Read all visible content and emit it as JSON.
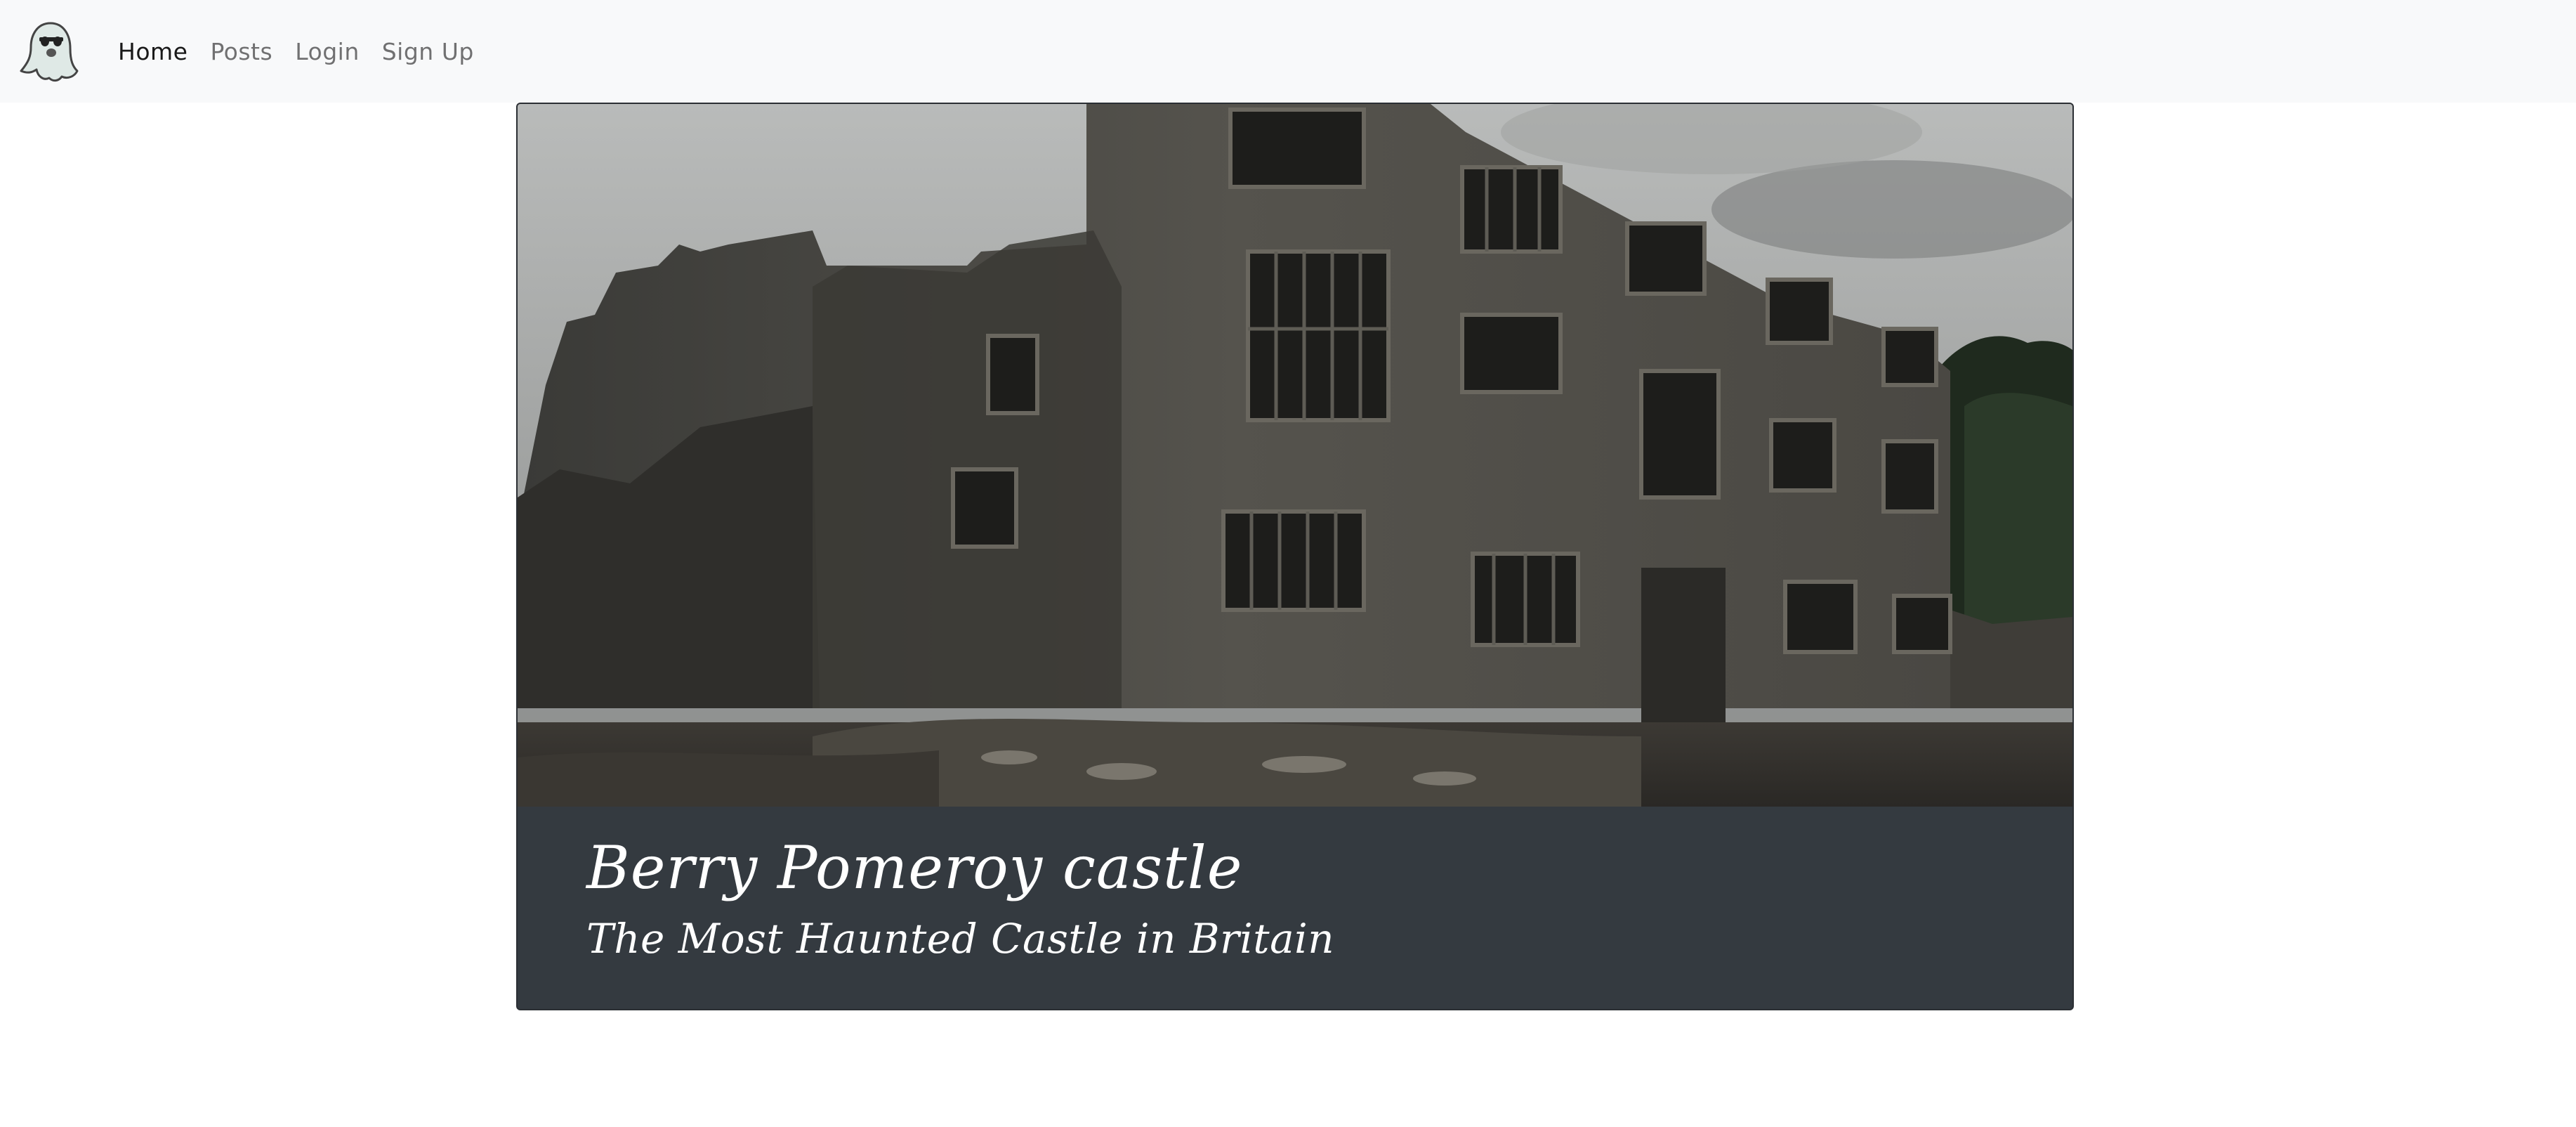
{
  "navbar": {
    "logo_icon": "ghost-icon",
    "links": [
      {
        "label": "Home",
        "active": true
      },
      {
        "label": "Posts",
        "active": false
      },
      {
        "label": "Login",
        "active": false
      },
      {
        "label": "Sign Up",
        "active": false
      }
    ]
  },
  "feature": {
    "image": "castle-ruin-photo",
    "title": "Berry Pomeroy castle",
    "subtitle": "The Most Haunted Castle in Britain"
  },
  "colors": {
    "navbar_bg": "#f8f9fa",
    "caption_bg": "#343a40",
    "caption_text": "#ffffff"
  }
}
